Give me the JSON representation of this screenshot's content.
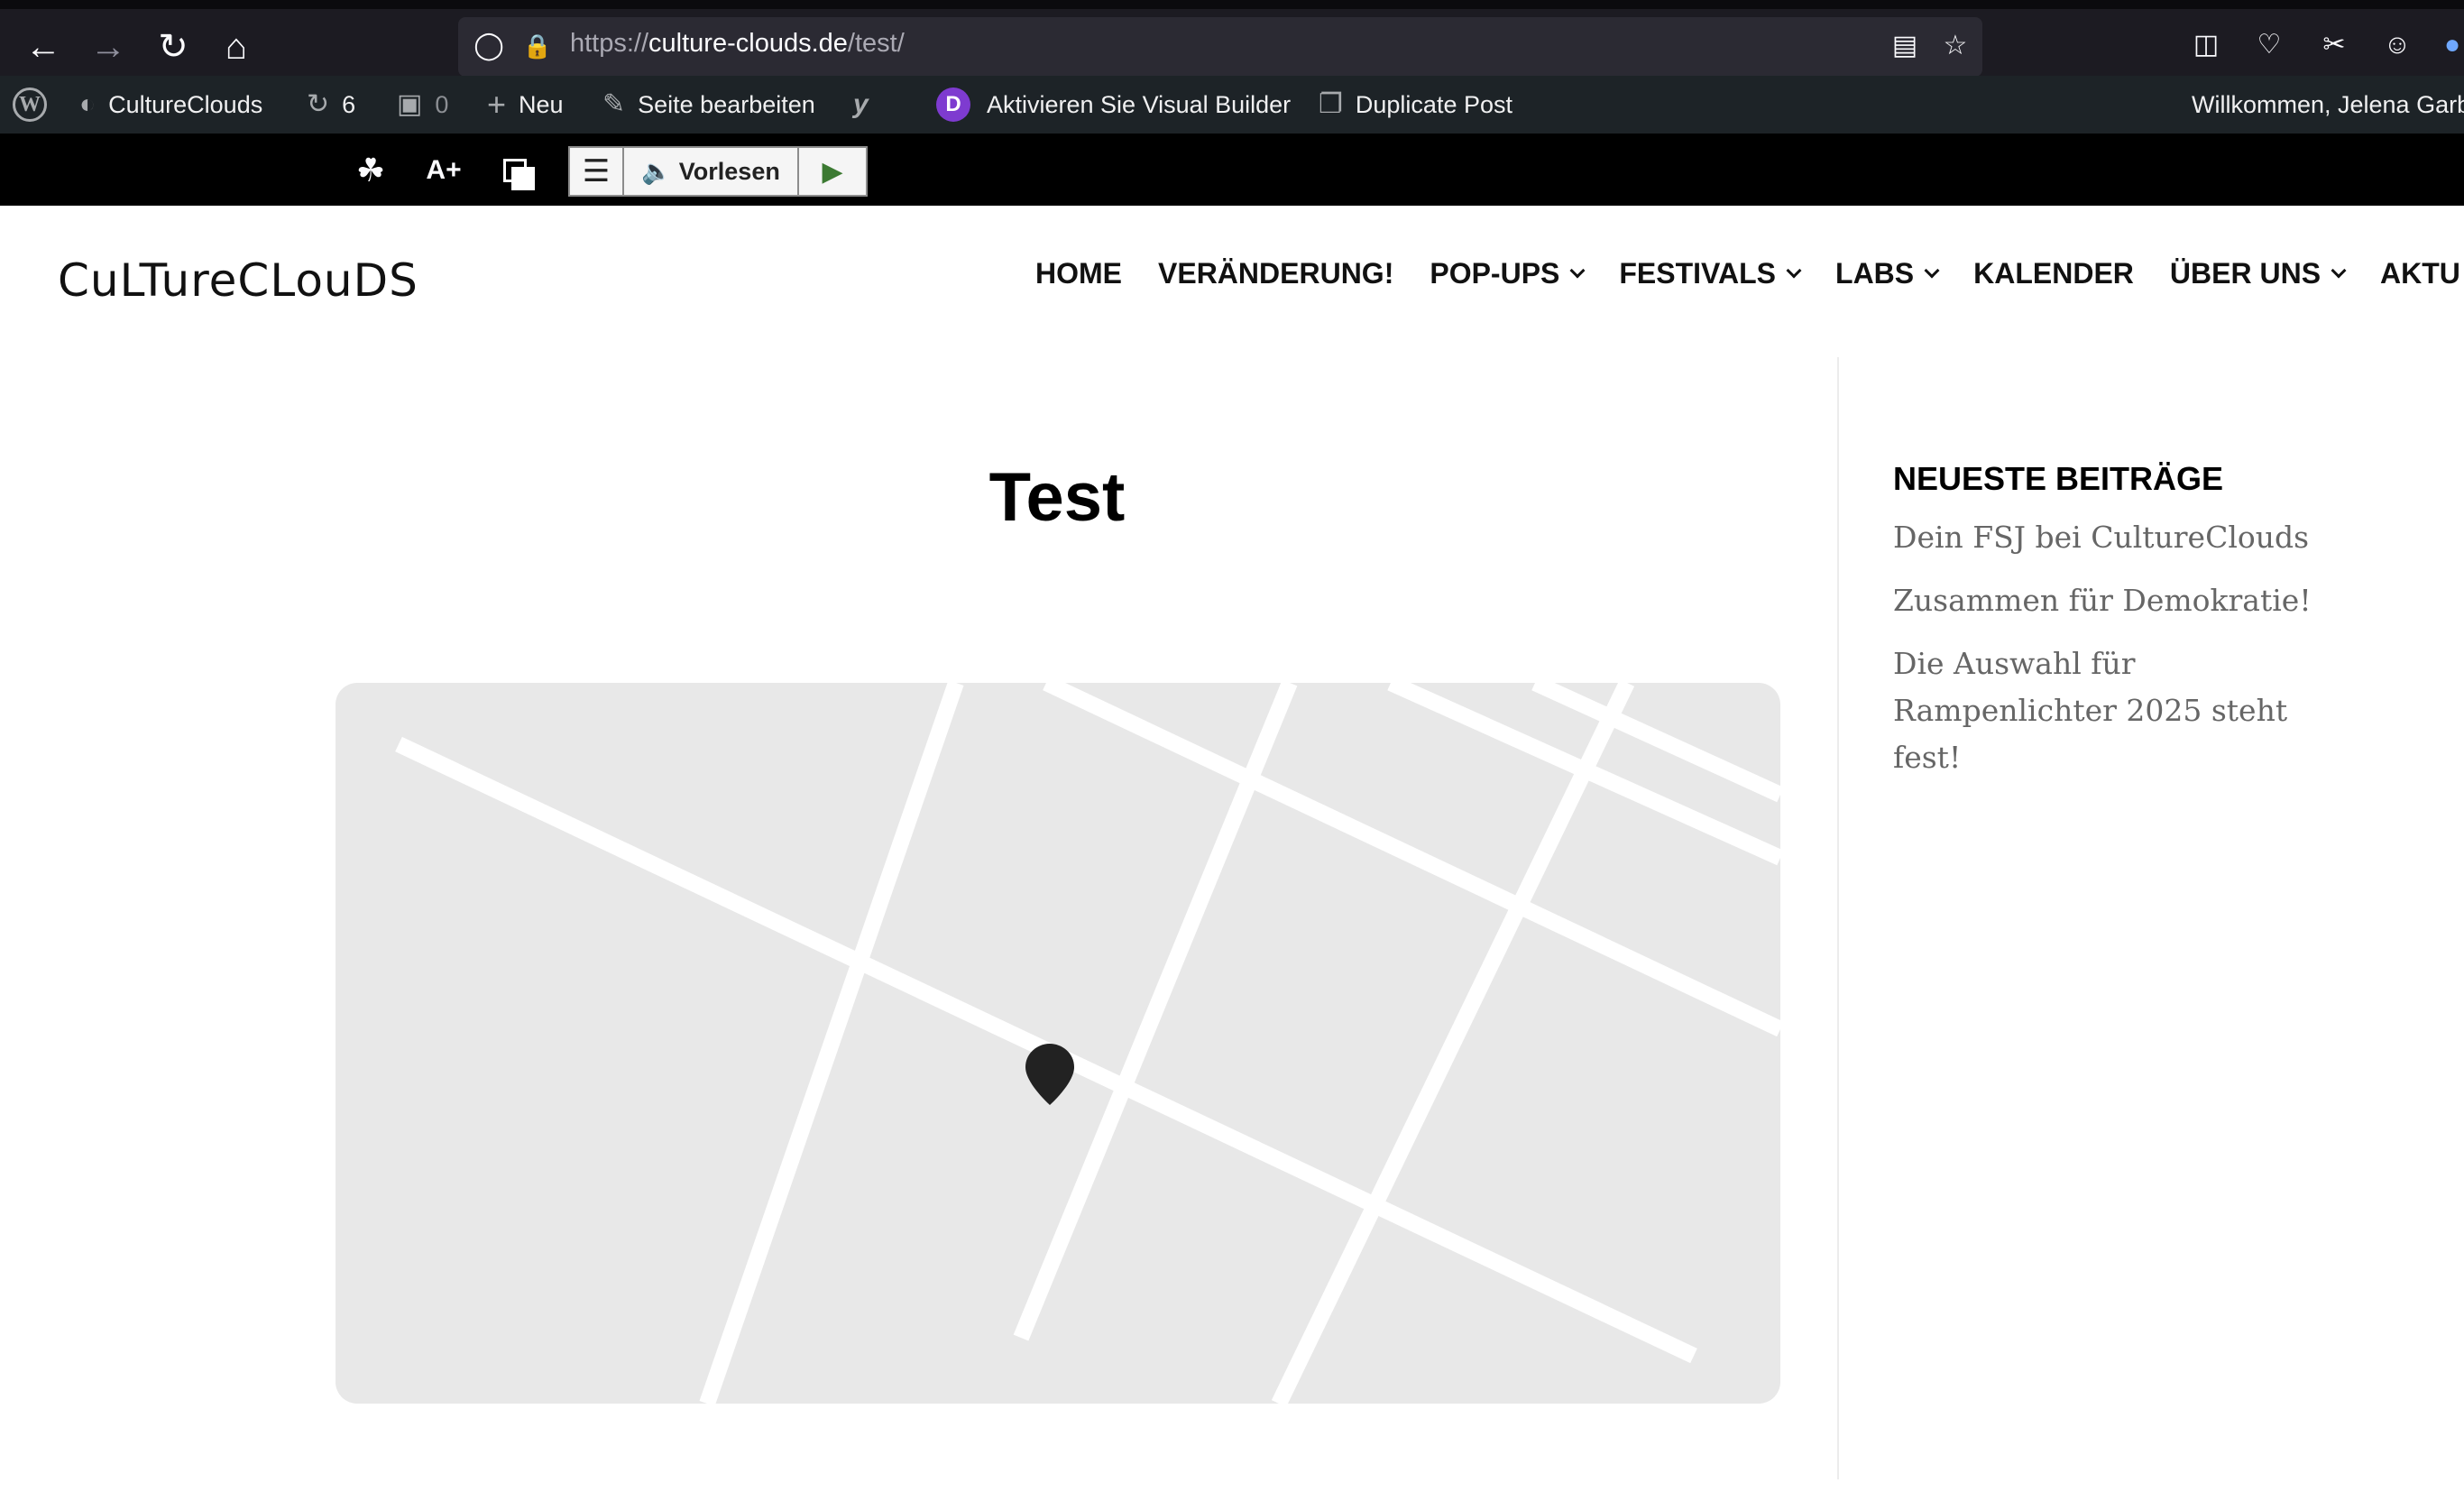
{
  "browser": {
    "url_scheme": "https://",
    "url_host": "culture-clouds.de",
    "url_path": "/test/",
    "back_icon": "arrow-left-icon",
    "forward_icon": "arrow-right-icon",
    "reload_icon": "reload-icon",
    "home_icon": "home-icon"
  },
  "admin_bar": {
    "site_name": "CultureClouds",
    "updates_count": "6",
    "comments_count": "0",
    "new_label": "Neu",
    "edit_label": "Seite bearbeiten",
    "divi_label": "Aktivieren Sie Visual Builder",
    "duplicate_label": "Duplicate Post",
    "welcome": "Willkommen, Jelena Garb"
  },
  "accessibility": {
    "font_size_label": "A+",
    "read_label": "Vorlesen"
  },
  "site": {
    "logo": "CuLTureCLouDS",
    "nav": [
      {
        "label": "HOME",
        "dropdown": false
      },
      {
        "label": "VERÄNDERUNG!",
        "dropdown": false
      },
      {
        "label": "POP-UPS",
        "dropdown": true
      },
      {
        "label": "FESTIVALS",
        "dropdown": true
      },
      {
        "label": "LABS",
        "dropdown": true
      },
      {
        "label": "KALENDER",
        "dropdown": false
      },
      {
        "label": "ÜBER UNS",
        "dropdown": true
      },
      {
        "label": "AKTU",
        "dropdown": false
      }
    ]
  },
  "page": {
    "title": "Test"
  },
  "sidebar": {
    "widget_title": "NEUESTE BEITRÄGE",
    "posts": [
      "Dein FSJ bei CultureClouds",
      "Zusammen für Demokratie!",
      "Die Auswahl für Rampenlichter 2025 steht fest!"
    ]
  },
  "colors": {
    "admin_bar": "#1d2327",
    "map_bg": "#e8e8e8",
    "divi_purple": "#7e3bd0"
  }
}
